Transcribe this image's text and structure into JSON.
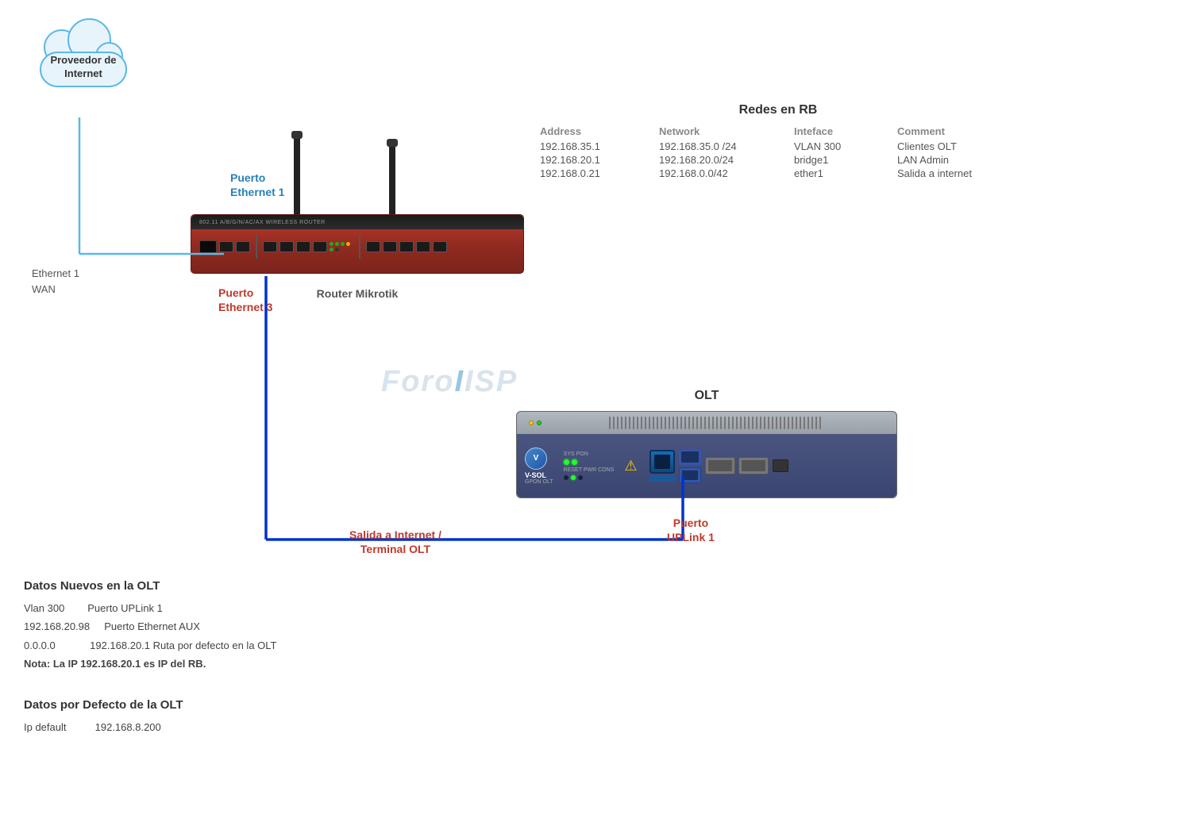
{
  "cloud": {
    "label_line1": "Proveedor de",
    "label_line2": "Internet"
  },
  "ethernet_wan": {
    "line1": "Ethernet 1",
    "line2": "WAN"
  },
  "puerto_eth1": {
    "line1": "Puerto",
    "line2": "Ethernet 1"
  },
  "puerto_eth3": {
    "line1": "Puerto",
    "line2": "Ethernet 3"
  },
  "router_label": "Router Mikrotik",
  "olt_title": "OLT",
  "puerto_uplink1": {
    "line1": "Puerto",
    "line2": "UPLink 1"
  },
  "salida_internet": {
    "line1": "Salida a Internet /",
    "line2": "Terminal  OLT"
  },
  "network_table": {
    "title": "Redes en RB",
    "headers": [
      "Address",
      "Network",
      "Inteface",
      "Comment"
    ],
    "rows": [
      [
        "192.168.35.1",
        "192.168.35.0 /24",
        "VLAN 300",
        "Clientes OLT"
      ],
      [
        "192.168.20.1",
        "192.168.20.0/24",
        "bridge1",
        "LAN Admin"
      ],
      [
        "192.168.0.21",
        "192.168.0.0/42",
        "ether1",
        "Salida a internet"
      ]
    ]
  },
  "datos_nuevos_olt": {
    "title": "Datos Nuevos en  la OLT",
    "rows": [
      {
        "col1": "Vlan 300",
        "col2": "Puerto UPLink 1"
      },
      {
        "col1": "192.168.20.98",
        "col2": "Puerto Ethernet AUX"
      },
      {
        "col1": "0.0.0.0",
        "col2": "192.168.20.1    Ruta  por defecto en la OLT"
      }
    ],
    "nota": "Nota: La IP 192.168.20.1 es IP del RB."
  },
  "datos_defecto_olt": {
    "title": "Datos por Defecto de la OLT",
    "rows": [
      {
        "col1": "Ip default",
        "col2": "192.168.8.200"
      }
    ]
  },
  "watermark": {
    "text1": "Foro",
    "text2": "ISP"
  }
}
